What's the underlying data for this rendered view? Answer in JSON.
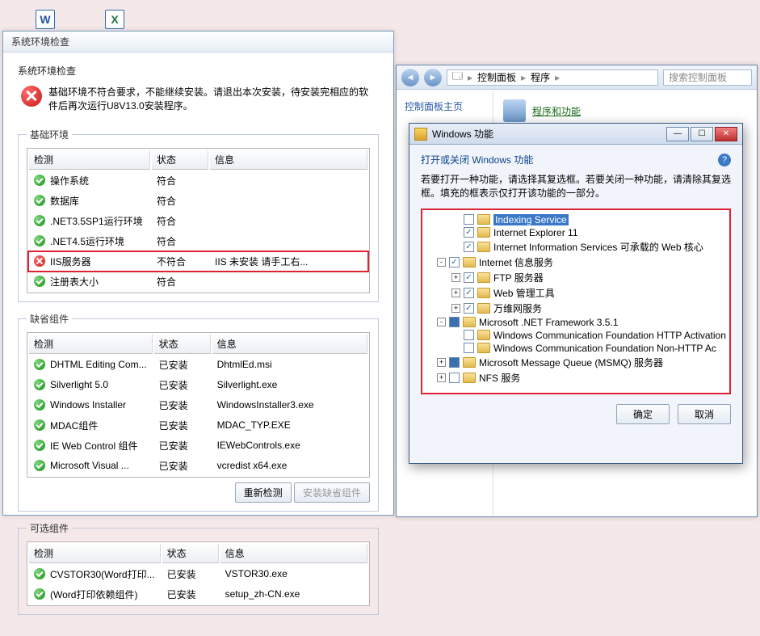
{
  "desktop": {
    "word": "W",
    "excel": "X"
  },
  "installer": {
    "window_title": "系统环境检查",
    "sub_title": "系统环境检查",
    "warning": "基础环境不符合要求，不能继续安装。请退出本次安装，待安装完相应的软件后再次运行U8V13.0安装程序。",
    "redetect_btn": "重新检测",
    "install_missing_btn": "安装缺省组件",
    "groups": {
      "basic": {
        "legend": "基础环境",
        "cols": {
          "check": "检测",
          "status": "状态",
          "info": "信息"
        },
        "rows": [
          {
            "ok": true,
            "check": "操作系统",
            "status": "符合",
            "info": ""
          },
          {
            "ok": true,
            "check": "数据库",
            "status": "符合",
            "info": ""
          },
          {
            "ok": true,
            "check": ".NET3.5SP1运行环境",
            "status": "符合",
            "info": ""
          },
          {
            "ok": true,
            "check": ".NET4.5运行环境",
            "status": "符合",
            "info": ""
          },
          {
            "ok": false,
            "check": "IIS服务器",
            "status": "不符合",
            "info": "IIS 未安装 请手工右...",
            "hl": true
          },
          {
            "ok": true,
            "check": "注册表大小",
            "status": "符合",
            "info": ""
          }
        ]
      },
      "missing": {
        "legend": "缺省组件",
        "cols": {
          "check": "检测",
          "status": "状态",
          "info": "信息"
        },
        "rows": [
          {
            "ok": true,
            "check": "DHTML Editing Com...",
            "status": "已安装",
            "info": "DhtmlEd.msi"
          },
          {
            "ok": true,
            "check": "Silverlight 5.0",
            "status": "已安装",
            "info": "Silverlight.exe"
          },
          {
            "ok": true,
            "check": "Windows Installer",
            "status": "已安装",
            "info": "WindowsInstaller3.exe"
          },
          {
            "ok": true,
            "check": "MDAC组件",
            "status": "已安装",
            "info": "MDAC_TYP.EXE"
          },
          {
            "ok": true,
            "check": "IE Web Control 组件",
            "status": "已安装",
            "info": "IEWebControls.exe"
          },
          {
            "ok": true,
            "check": "Microsoft Visual ...",
            "status": "已安装",
            "info": "vcredist x64.exe"
          }
        ]
      },
      "optional": {
        "legend": "可选组件",
        "cols": {
          "check": "检测",
          "status": "状态",
          "info": "信息"
        },
        "rows": [
          {
            "ok": true,
            "check": "CVSTOR30(Word打印...",
            "status": "已安装",
            "info": "VSTOR30.exe"
          },
          {
            "ok": true,
            "check": "(Word打印依赖组件)",
            "status": "已安装",
            "info": "setup_zh-CN.exe"
          }
        ]
      }
    }
  },
  "cp": {
    "breadcrumb": {
      "a": "控制面板",
      "b": "程序"
    },
    "search_placeholder": "搜索控制面板",
    "side_title": "控制面板主页",
    "link": "程序和功能"
  },
  "feat": {
    "title": "Windows 功能",
    "heading": "打开或关闭 Windows 功能",
    "desc": "若要打开一种功能，请选择其复选框。若要关闭一种功能，请清除其复选框。填充的框表示仅打开该功能的一部分。",
    "ok": "确定",
    "cancel": "取消",
    "items": [
      {
        "ind": 2,
        "exp": "",
        "cb": "",
        "label": "Indexing Service",
        "sel": true
      },
      {
        "ind": 2,
        "exp": "",
        "cb": "checked",
        "label": "Internet Explorer 11"
      },
      {
        "ind": 2,
        "exp": "",
        "cb": "checked",
        "label": "Internet Information Services 可承载的 Web 核心"
      },
      {
        "ind": 1,
        "exp": "-",
        "cb": "checked",
        "label": "Internet 信息服务"
      },
      {
        "ind": 2,
        "exp": "+",
        "cb": "checked",
        "label": "FTP 服务器"
      },
      {
        "ind": 2,
        "exp": "+",
        "cb": "checked",
        "label": "Web 管理工具"
      },
      {
        "ind": 2,
        "exp": "+",
        "cb": "checked",
        "label": "万维网服务"
      },
      {
        "ind": 1,
        "exp": "-",
        "cb": "filled",
        "label": "Microsoft .NET Framework 3.5.1"
      },
      {
        "ind": 2,
        "exp": "",
        "cb": "",
        "label": "Windows Communication Foundation HTTP Activation"
      },
      {
        "ind": 2,
        "exp": "",
        "cb": "",
        "label": "Windows Communication Foundation Non-HTTP Ac"
      },
      {
        "ind": 1,
        "exp": "+",
        "cb": "filled",
        "label": "Microsoft Message Queue (MSMQ) 服务器",
        "strike": true
      },
      {
        "ind": 1,
        "exp": "+",
        "cb": "",
        "label": "NFS 服务"
      }
    ]
  }
}
